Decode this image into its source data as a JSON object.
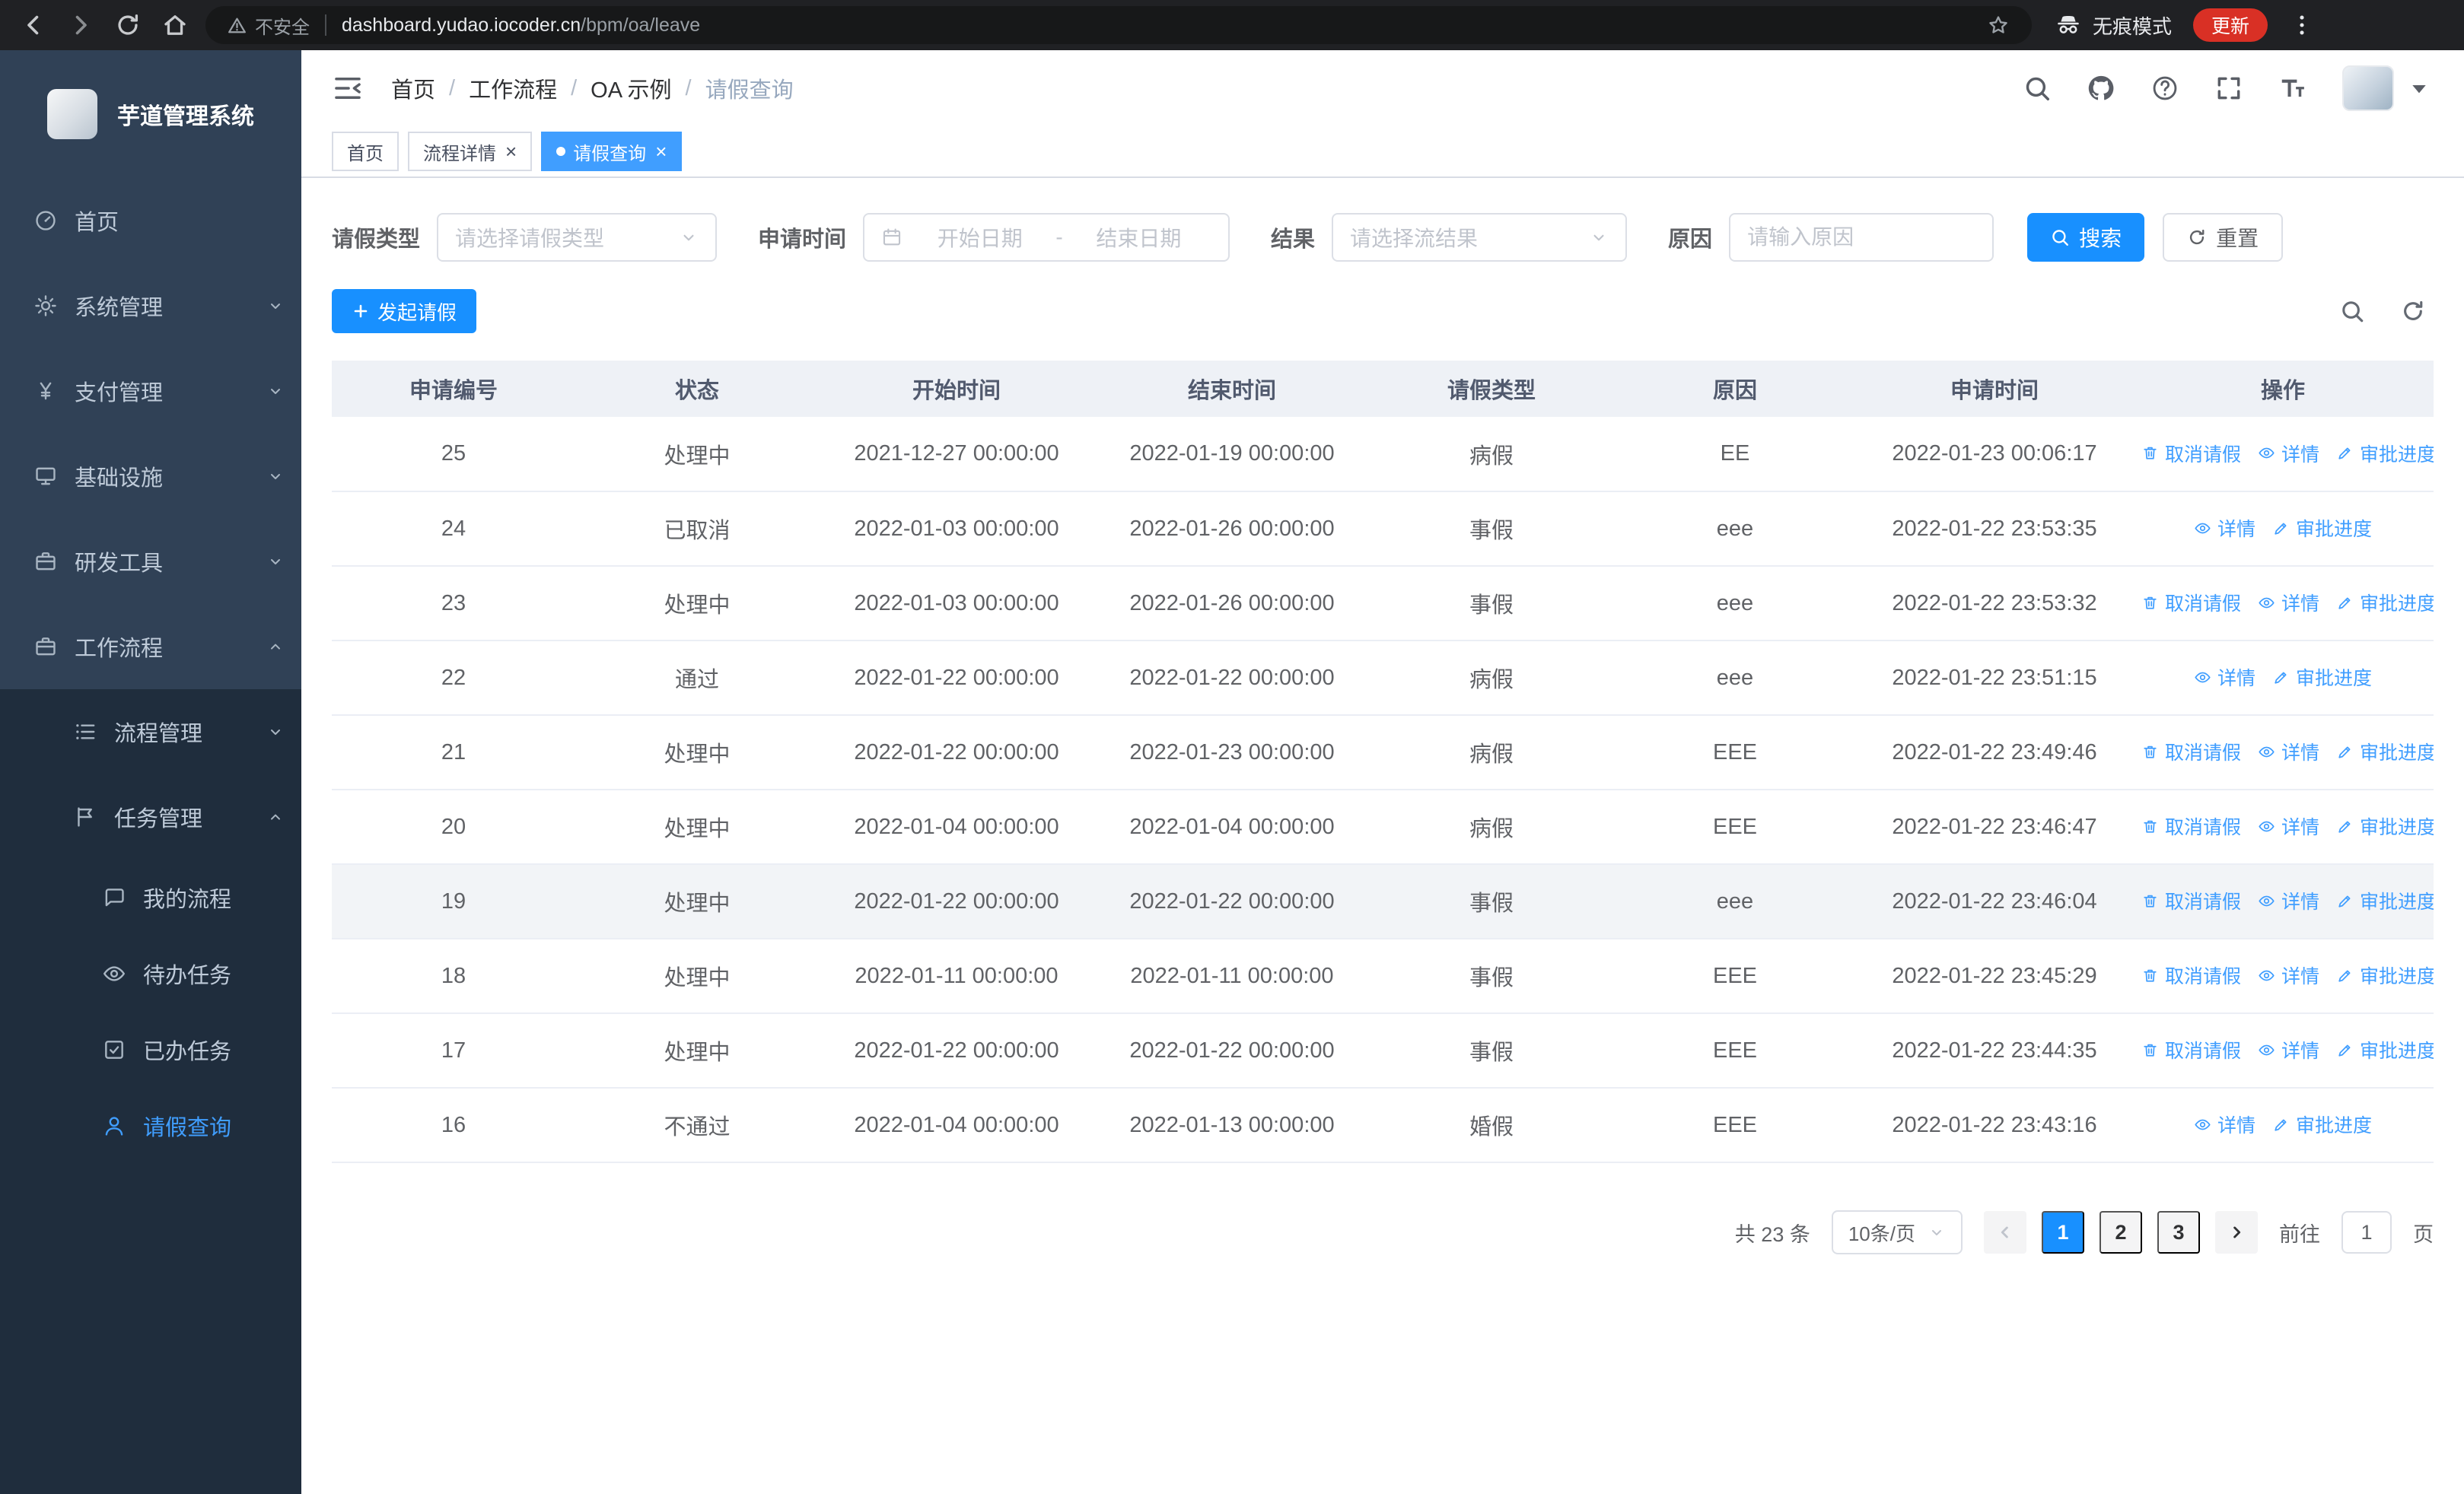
{
  "browser": {
    "security_label": "不安全",
    "url_host": "dashboard.yudao.iocoder.cn",
    "url_path": "/bpm/oa/leave",
    "incognito_label": "无痕模式",
    "update_label": "更新"
  },
  "sidebar": {
    "title": "芋道管理系统",
    "items": [
      {
        "key": "home",
        "label": "首页",
        "icon": "dashboard",
        "level": 1
      },
      {
        "key": "system",
        "label": "系统管理",
        "icon": "gear",
        "level": 1,
        "chevron": "down"
      },
      {
        "key": "payment",
        "label": "支付管理",
        "icon": "yen",
        "level": 1,
        "chevron": "down"
      },
      {
        "key": "infrastructure",
        "label": "基础设施",
        "icon": "infra",
        "level": 1,
        "chevron": "down"
      },
      {
        "key": "devtools",
        "label": "研发工具",
        "icon": "briefcase",
        "level": 1,
        "chevron": "down"
      },
      {
        "key": "workflow",
        "label": "工作流程",
        "icon": "briefcase",
        "level": 1,
        "chevron": "up"
      },
      {
        "key": "process-mgmt",
        "label": "流程管理",
        "icon": "listtree",
        "level": 2,
        "chevron": "down"
      },
      {
        "key": "task-mgmt",
        "label": "任务管理",
        "icon": "flag",
        "level": 2,
        "chevron": "up"
      },
      {
        "key": "my-process",
        "label": "我的流程",
        "icon": "chat",
        "level": 3
      },
      {
        "key": "todo-tasks",
        "label": "待办任务",
        "icon": "eye",
        "level": 3
      },
      {
        "key": "done-tasks",
        "label": "已办任务",
        "icon": "checksq",
        "level": 3
      },
      {
        "key": "leave-query",
        "label": "请假查询",
        "icon": "user",
        "level": 3,
        "active": true
      }
    ]
  },
  "header": {
    "breadcrumb": [
      "首页",
      "工作流程",
      "OA 示例",
      "请假查询"
    ]
  },
  "tabs": [
    {
      "key": "home",
      "label": "首页",
      "closable": false,
      "active": false
    },
    {
      "key": "process-detail",
      "label": "流程详情",
      "closable": true,
      "active": false
    },
    {
      "key": "leave-query",
      "label": "请假查询",
      "closable": true,
      "active": true
    }
  ],
  "filters": {
    "leave_type_label": "请假类型",
    "leave_type_placeholder": "请选择请假类型",
    "apply_time_label": "申请时间",
    "start_date_placeholder": "开始日期",
    "range_separator": "-",
    "end_date_placeholder": "结束日期",
    "result_label": "结果",
    "result_placeholder": "请选择流结果",
    "reason_label": "原因",
    "reason_placeholder": "请输入原因",
    "search_label": "搜索",
    "reset_label": "重置"
  },
  "toolbar": {
    "create_label": "发起请假"
  },
  "table": {
    "columns": [
      "申请编号",
      "状态",
      "开始时间",
      "结束时间",
      "请假类型",
      "原因",
      "申请时间",
      "操作"
    ],
    "action_labels": {
      "cancel": "取消请假",
      "detail": "详情",
      "progress": "审批进度"
    },
    "rows": [
      {
        "id": "25",
        "status": "处理中",
        "start": "2021-12-27 00:00:00",
        "end": "2022-01-19 00:00:00",
        "type": "病假",
        "reason": "EE",
        "applied": "2022-01-23 00:06:17",
        "actions": [
          "cancel",
          "detail",
          "progress"
        ],
        "highlight": false
      },
      {
        "id": "24",
        "status": "已取消",
        "start": "2022-01-03 00:00:00",
        "end": "2022-01-26 00:00:00",
        "type": "事假",
        "reason": "eee",
        "applied": "2022-01-22 23:53:35",
        "actions": [
          "detail",
          "progress"
        ],
        "highlight": false
      },
      {
        "id": "23",
        "status": "处理中",
        "start": "2022-01-03 00:00:00",
        "end": "2022-01-26 00:00:00",
        "type": "事假",
        "reason": "eee",
        "applied": "2022-01-22 23:53:32",
        "actions": [
          "cancel",
          "detail",
          "progress"
        ],
        "highlight": false
      },
      {
        "id": "22",
        "status": "通过",
        "start": "2022-01-22 00:00:00",
        "end": "2022-01-22 00:00:00",
        "type": "病假",
        "reason": "eee",
        "applied": "2022-01-22 23:51:15",
        "actions": [
          "detail",
          "progress"
        ],
        "highlight": false
      },
      {
        "id": "21",
        "status": "处理中",
        "start": "2022-01-22 00:00:00",
        "end": "2022-01-23 00:00:00",
        "type": "病假",
        "reason": "EEE",
        "applied": "2022-01-22 23:49:46",
        "actions": [
          "cancel",
          "detail",
          "progress"
        ],
        "highlight": false
      },
      {
        "id": "20",
        "status": "处理中",
        "start": "2022-01-04 00:00:00",
        "end": "2022-01-04 00:00:00",
        "type": "病假",
        "reason": "EEE",
        "applied": "2022-01-22 23:46:47",
        "actions": [
          "cancel",
          "detail",
          "progress"
        ],
        "highlight": false
      },
      {
        "id": "19",
        "status": "处理中",
        "start": "2022-01-22 00:00:00",
        "end": "2022-01-22 00:00:00",
        "type": "事假",
        "reason": "eee",
        "applied": "2022-01-22 23:46:04",
        "actions": [
          "cancel",
          "detail",
          "progress"
        ],
        "highlight": true
      },
      {
        "id": "18",
        "status": "处理中",
        "start": "2022-01-11 00:00:00",
        "end": "2022-01-11 00:00:00",
        "type": "事假",
        "reason": "EEE",
        "applied": "2022-01-22 23:45:29",
        "actions": [
          "cancel",
          "detail",
          "progress"
        ],
        "highlight": false
      },
      {
        "id": "17",
        "status": "处理中",
        "start": "2022-01-22 00:00:00",
        "end": "2022-01-22 00:00:00",
        "type": "事假",
        "reason": "EEE",
        "applied": "2022-01-22 23:44:35",
        "actions": [
          "cancel",
          "detail",
          "progress"
        ],
        "highlight": false
      },
      {
        "id": "16",
        "status": "不通过",
        "start": "2022-01-04 00:00:00",
        "end": "2022-01-13 00:00:00",
        "type": "婚假",
        "reason": "EEE",
        "applied": "2022-01-22 23:43:16",
        "actions": [
          "detail",
          "progress"
        ],
        "highlight": false
      }
    ]
  },
  "pagination": {
    "total_label": "共 23 条",
    "page_size": "10条/页",
    "pages": [
      "1",
      "2",
      "3"
    ],
    "active_page": "1",
    "goto_label": "前往",
    "goto_value": "1",
    "goto_suffix": "页"
  },
  "colors": {
    "primary": "#409eff",
    "button_blue": "#1890ff",
    "sidebar_bg": "#304156",
    "sidebar_submenu_bg": "#1f2d3d",
    "update_pill": "#d93025"
  }
}
